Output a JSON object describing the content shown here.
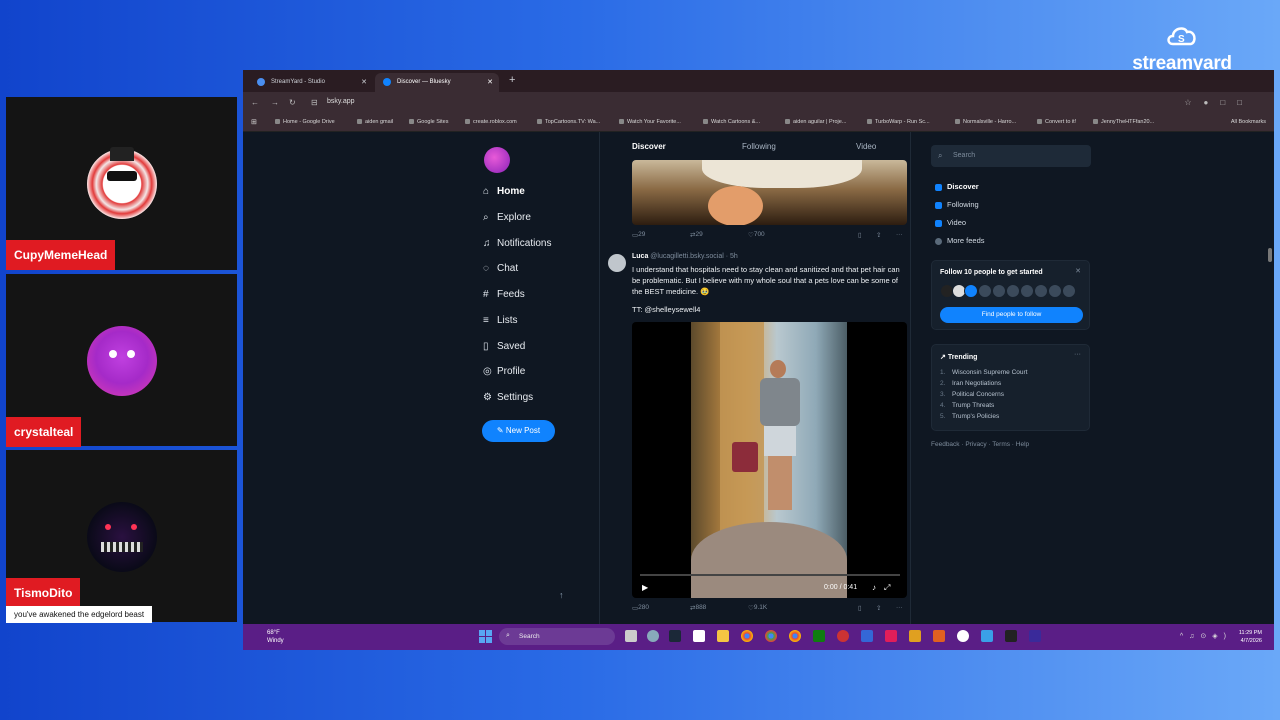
{
  "overlay": {
    "brand": "streamyard",
    "participants": [
      {
        "name": "CupyMemeHead"
      },
      {
        "name": "crystalteal"
      },
      {
        "name": "TismoDito",
        "caption": "you've awakened the edgelord beast"
      }
    ]
  },
  "browser": {
    "tabs": [
      {
        "title": "StreamYard - Studio"
      },
      {
        "title": "Discover — Bluesky"
      }
    ],
    "url": "bsky.app",
    "bookmarks": [
      "Home - Google Drive",
      "aiden gmail",
      "Google Sites",
      "create.roblox.com",
      "TopCartoons.TV: Wa...",
      "Watch Your Favorite...",
      "Watch Cartoons &...",
      "aiden aguilar | Proje...",
      "TurboWarp - Run Sc...",
      "Normalsville - Harro...",
      "Convert to it!",
      "JennyTheHTFfan20..."
    ],
    "all_bookmarks": "All Bookmarks"
  },
  "nav": {
    "items": [
      {
        "label": "Home",
        "icon": "home-icon"
      },
      {
        "label": "Explore",
        "icon": "search-icon"
      },
      {
        "label": "Notifications",
        "icon": "bell-icon"
      },
      {
        "label": "Chat",
        "icon": "chat-icon"
      },
      {
        "label": "Feeds",
        "icon": "hash-icon"
      },
      {
        "label": "Lists",
        "icon": "list-icon"
      },
      {
        "label": "Saved",
        "icon": "bookmark-icon"
      },
      {
        "label": "Profile",
        "icon": "profile-icon"
      },
      {
        "label": "Settings",
        "icon": "gear-icon"
      }
    ],
    "new_post": "New Post"
  },
  "feed": {
    "tabs": [
      "Discover",
      "Following",
      "Video"
    ],
    "post1_actions": {
      "replies": "29",
      "reposts": "29",
      "likes": "700"
    },
    "post2": {
      "name": "Luca",
      "handle": "@lucagilletti.bsky.social · 5h",
      "text": "I understand that hospitals need to stay clean and sanitized and that pet hair can be problematic. But I believe with my whole soul that a pets love can be some of the BEST medicine. 🥹",
      "tt": "TT: @shelleysewell4",
      "video_time": "0:00 / 0:41",
      "actions": {
        "replies": "280",
        "reposts": "888",
        "likes": "9.1K"
      }
    }
  },
  "sidebar": {
    "search_placeholder": "Search",
    "feeds": [
      "Discover",
      "Following",
      "Video",
      "More feeds"
    ],
    "follow_card": {
      "title": "Follow 10 people to get started",
      "button": "Find people to follow"
    },
    "trending_title": "Trending",
    "trending": [
      {
        "num": "1.",
        "label": "Wisconsin Supreme Court"
      },
      {
        "num": "2.",
        "label": "Iran Negotiations"
      },
      {
        "num": "3.",
        "label": "Political Concerns"
      },
      {
        "num": "4.",
        "label": "Trump Threats"
      },
      {
        "num": "5.",
        "label": "Trump's Policies"
      }
    ],
    "footer": "Feedback · Privacy · Terms · Help"
  },
  "taskbar": {
    "temp": "68°F",
    "weather": "Windy",
    "search": "Search",
    "time": "11:29 PM",
    "date": "4/7/2026"
  }
}
